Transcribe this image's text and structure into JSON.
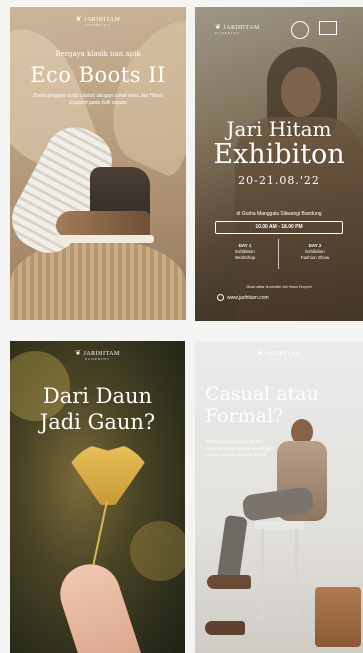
{
  "brand": {
    "name": "JARIHITAM",
    "tagline": "ECOPRINT"
  },
  "posters": [
    {
      "tagline": "Bergaya klasik nan apik",
      "title": "Eco Boots II",
      "description": "Boots bergaya rustic classic dengan corak khas Jari Hitam Ecoprint pada kulit sepatu"
    },
    {
      "title_line1": "Jari Hitam",
      "title_line2": "Exhibiton",
      "dates": "20-21.08.'22",
      "venue": "di Graha Manggala Siliwangi Bandung",
      "time": "10.00 AM - 18.00 PM",
      "day1": {
        "label": "DAY 1",
        "line1": "Exhibition",
        "line2": "Workshop"
      },
      "day2": {
        "label": "DAY 2",
        "line1": "Exhibition",
        "line2": "Fashion Show"
      },
      "note": "Mulai daftar di website Jari Hitam Ecoprint",
      "website": "www.jarihitam.com"
    },
    {
      "title_line1": "Dari Daun",
      "title_line2": "Jadi Gaun?"
    },
    {
      "title_line1": "Casual atau",
      "title_line2": "Formal?",
      "description": "Sebab perlu khawatir, karena Ecoprint cocok digunakan sebagai pakaian casual ataupun formal"
    }
  ],
  "colors": {
    "page_bg": "#f4f4f3",
    "text": "#ffffff"
  }
}
